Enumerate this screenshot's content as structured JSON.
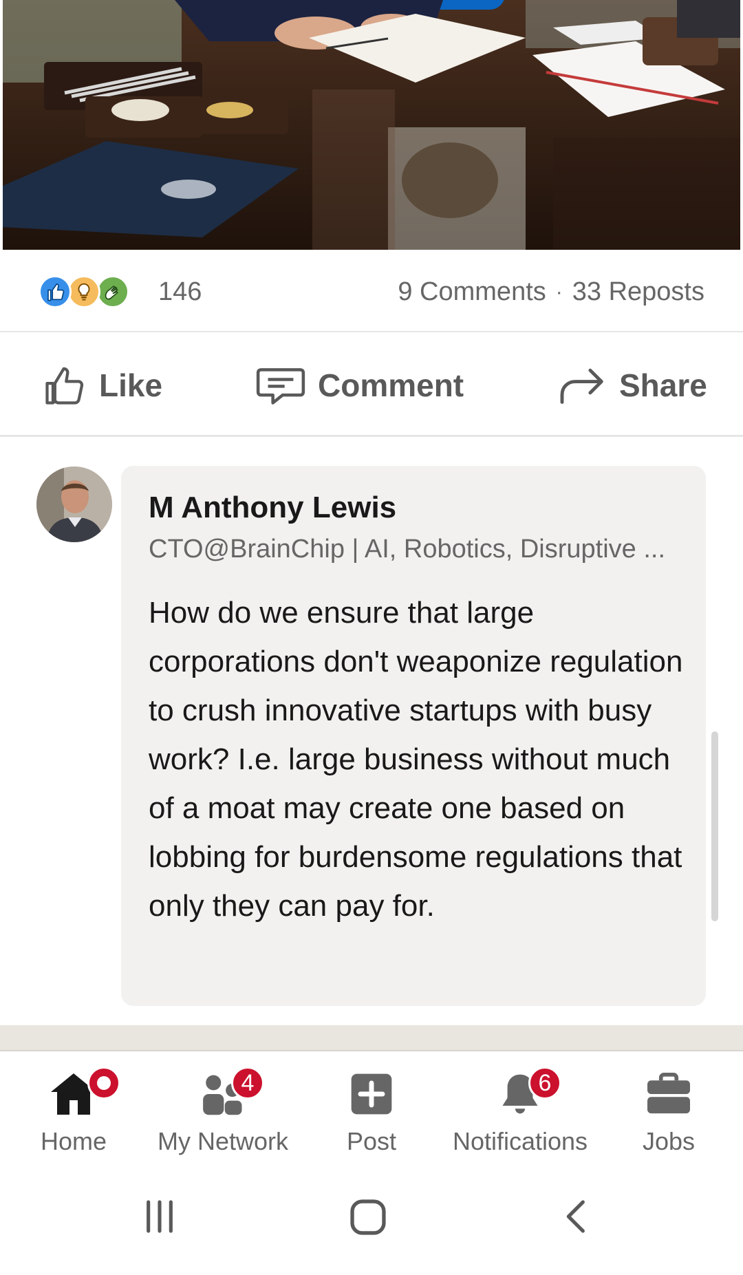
{
  "post": {
    "image_alt": "Photo of a person signing a document at a wooden desk"
  },
  "social_counts": {
    "reaction_count": "146",
    "comments": "9 Comments",
    "separator": "·",
    "reposts": "33 Reposts",
    "reaction_icons": [
      "like-reaction-icon",
      "insightful-reaction-icon",
      "celebrate-reaction-icon"
    ]
  },
  "actions": {
    "like_label": "Like",
    "comment_label": "Comment",
    "share_label": "Share"
  },
  "comment": {
    "author": "M Anthony Lewis",
    "headline": "CTO@BrainChip | AI, Robotics, Disruptive ...",
    "text": "How do we ensure that large corporations don't weaponize regulation to crush innovative startups with busy work? I.e. large business without much of a moat may create one based on lobbing for burdensome regulations that only they can pay for."
  },
  "bottom_nav": {
    "items": [
      {
        "label": "Home",
        "icon": "home-icon",
        "badge": ""
      },
      {
        "label": "My Network",
        "icon": "network-icon",
        "badge": "4"
      },
      {
        "label": "Post",
        "icon": "post-icon",
        "badge": ""
      },
      {
        "label": "Notifications",
        "icon": "bell-icon",
        "badge": "6"
      },
      {
        "label": "Jobs",
        "icon": "briefcase-icon",
        "badge": ""
      }
    ]
  },
  "colors": {
    "brand_blue": "#0a66c2",
    "badge_red": "#cb112d",
    "text_secondary": "#666666",
    "bubble_bg": "#f2f1ef"
  }
}
